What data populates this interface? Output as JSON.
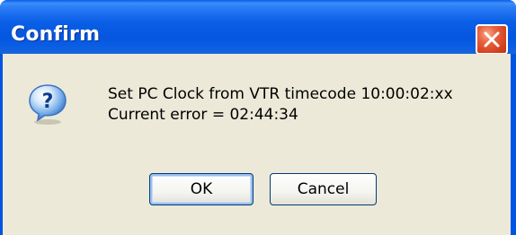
{
  "window": {
    "title": "Confirm"
  },
  "icons": {
    "dialog_icon": "question-icon",
    "close_icon": "close-icon"
  },
  "message": {
    "line1": "Set PC Clock from VTR timecode 10:00:02:xx",
    "line2": "Current error = 02:44:34"
  },
  "buttons": {
    "ok_label": "OK",
    "cancel_label": "Cancel"
  },
  "colors": {
    "titlebar_blue": "#0a5fe6",
    "client_background": "#ece9d8",
    "close_button_red": "#d43f1c"
  }
}
